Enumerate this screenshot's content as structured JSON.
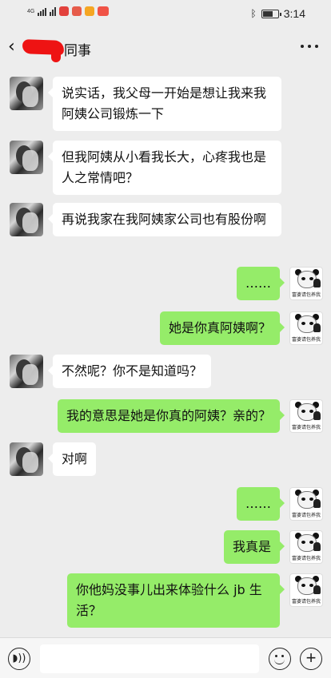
{
  "status_bar": {
    "network": "4G",
    "time": "3:14",
    "icons": [
      "signal-icon",
      "wifi-icon",
      "app-notification-icon",
      "app-notification-icon",
      "bluetooth-icon",
      "battery-icon"
    ]
  },
  "header": {
    "back_icon": "chevron-left-icon",
    "title_visible": "同事",
    "more_icon": "more-dots-icon"
  },
  "messages": [
    {
      "side": "left",
      "text": "说实话，我父母一开始是想让我来我阿姨公司锻炼一下"
    },
    {
      "side": "left",
      "text": "但我阿姨从小看我长大，心疼我也是人之常情吧？"
    },
    {
      "side": "left",
      "text": "再说我家在我阿姨家公司也有股份啊"
    },
    {
      "side": "right",
      "text": "……"
    },
    {
      "side": "right",
      "text": "她是你真阿姨啊？"
    },
    {
      "side": "left",
      "text": "不然呢？你不是知道吗？"
    },
    {
      "side": "right",
      "text": "我的意思是她是你真的阿姨？亲的？"
    },
    {
      "side": "left",
      "text": "对啊"
    },
    {
      "side": "right",
      "text": "……"
    },
    {
      "side": "right",
      "text": "我真是"
    },
    {
      "side": "right",
      "text": "你他妈没事儿出来体验什么 jb 生活？"
    }
  ],
  "avatar_caption": "富婆请包养我",
  "input_bar": {
    "voice_icon": "voice-icon",
    "emoji_icon": "emoji-icon",
    "plus_icon": "plus-icon",
    "input_placeholder": ""
  },
  "colors": {
    "background": "#ededed",
    "sent_bubble": "#95ec69",
    "received_bubble": "#ffffff"
  }
}
